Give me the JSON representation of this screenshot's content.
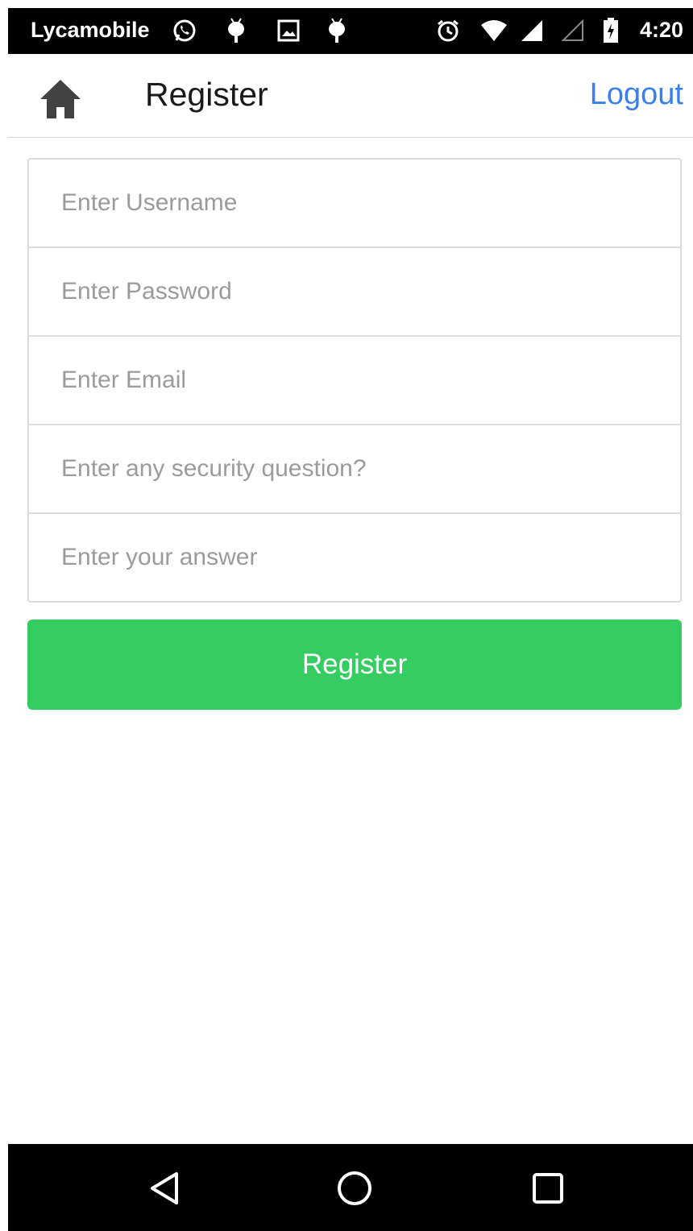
{
  "status_bar": {
    "carrier": "Lycamobile",
    "time": "4:20",
    "icons": [
      "whatsapp-icon",
      "android-debug-icon",
      "image-icon",
      "android-debug-icon",
      "alarm-icon",
      "wifi-icon",
      "signal-icon",
      "signal-empty-icon",
      "battery-charging-icon"
    ]
  },
  "header": {
    "home_icon": "home-icon",
    "title": "Register",
    "logout_label": "Logout"
  },
  "form": {
    "username_placeholder": "Enter Username",
    "password_placeholder": "Enter Password",
    "email_placeholder": "Enter Email",
    "question_placeholder": "Enter any security question?",
    "answer_placeholder": "Enter your answer",
    "submit_label": "Register"
  },
  "nav_bar": {
    "icons": [
      "back-icon",
      "home-circle-icon",
      "recents-icon"
    ]
  },
  "colors": {
    "accent": "#3a7ff0",
    "button": "#35cd61",
    "status_bar": "#000000"
  }
}
